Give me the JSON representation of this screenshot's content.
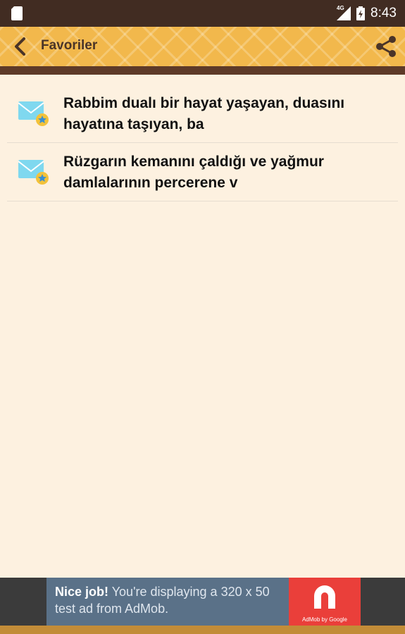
{
  "status_bar": {
    "time": "8:43",
    "network": "4G"
  },
  "toolbar": {
    "title": "Favoriler",
    "back_icon": "chevron-left-icon",
    "share_icon": "share-icon"
  },
  "list": {
    "items": [
      {
        "text": "Rabbim dualı bir hayat yaşayan, duasını hayatına taşıyan, ba",
        "icon": "mail-star-icon"
      },
      {
        "text": "Rüzgarın kemanını çaldığı ve yağmur damlalarının percerene v",
        "icon": "mail-star-icon"
      }
    ]
  },
  "ad": {
    "headline": "Nice job!",
    "body": " You're displaying a 320 x 50 test ad from AdMob.",
    "logo_caption": "AdMob by Google"
  },
  "colors": {
    "status_bar": "#412c22",
    "toolbar": "#f2b84c",
    "toolbar_border": "#5e3a28",
    "background": "#fdf1e0",
    "ad_banner": "#5a7188",
    "ad_logo": "#ea3f3a"
  }
}
